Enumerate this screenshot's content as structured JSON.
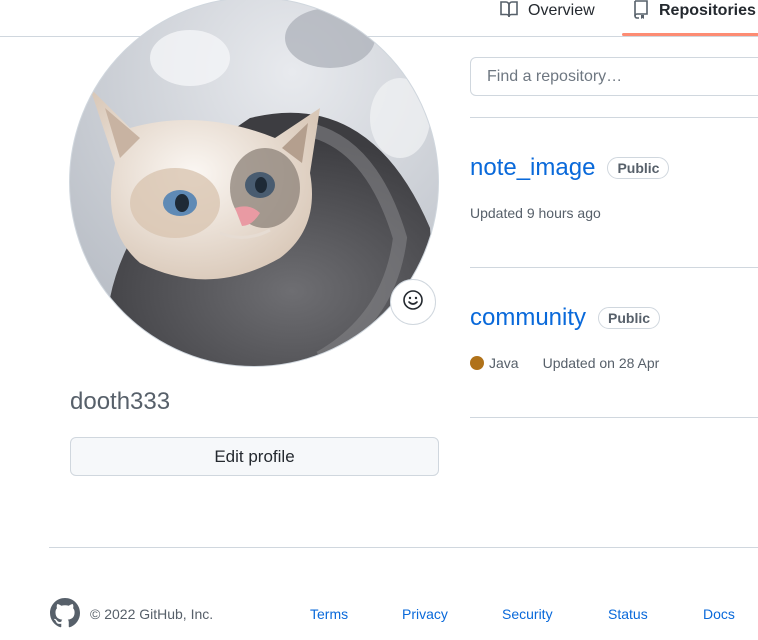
{
  "nav": {
    "tabs": [
      {
        "label": "Overview",
        "icon": "book-icon"
      },
      {
        "label": "Repositories",
        "icon": "repo-icon",
        "selected": true
      }
    ],
    "accent_color": "#fd8c73"
  },
  "profile": {
    "username": "dooth333",
    "edit_label": "Edit profile",
    "status_icon": "smiley-icon"
  },
  "search": {
    "placeholder": "Find a repository…"
  },
  "repos": [
    {
      "name": "note_image",
      "visibility": "Public",
      "language": "",
      "updated": "Updated 9 hours ago"
    },
    {
      "name": "community",
      "visibility": "Public",
      "language": "Java",
      "language_color": "#b07219",
      "updated": "Updated on 28 Apr"
    }
  ],
  "footer": {
    "copyright": "© 2022 GitHub, Inc.",
    "links": [
      "Terms",
      "Privacy",
      "Security",
      "Status",
      "Docs"
    ]
  }
}
